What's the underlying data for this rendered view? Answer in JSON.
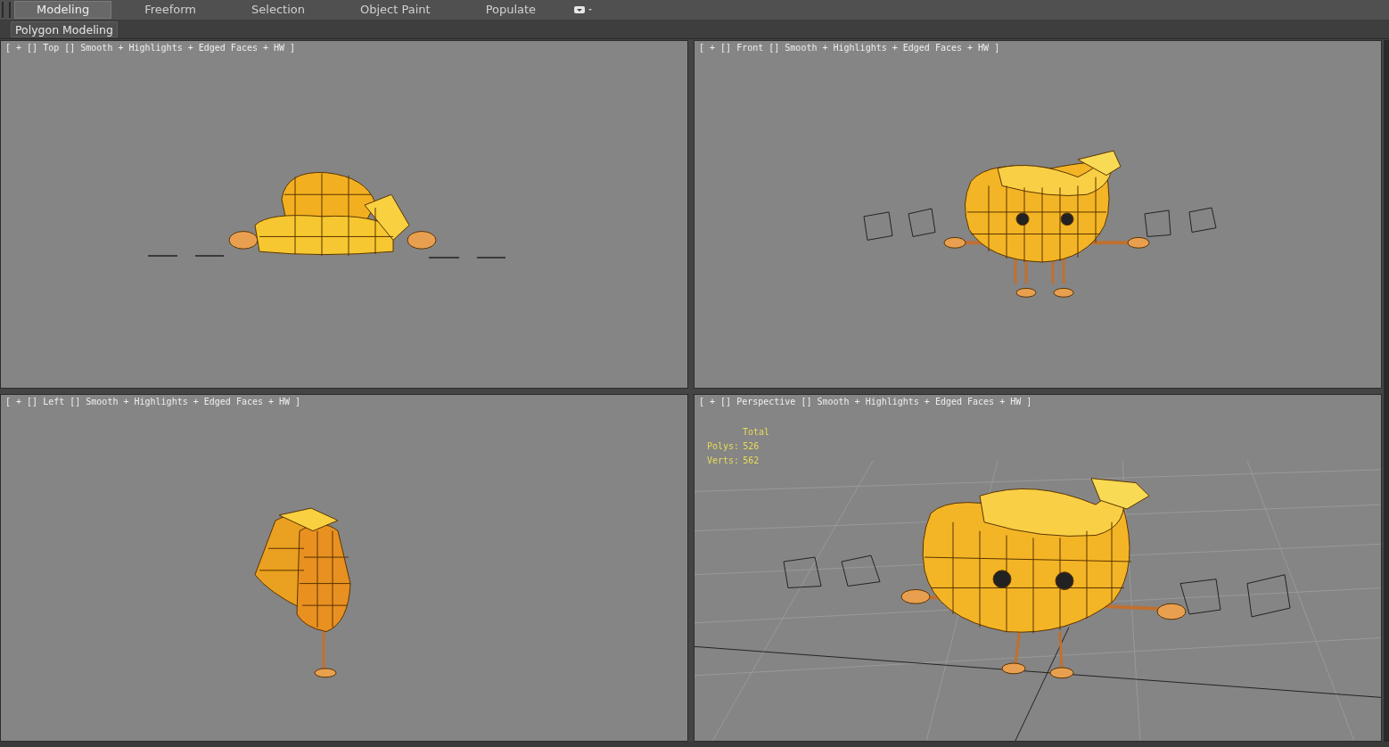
{
  "ribbon": {
    "tabs": [
      {
        "label": "Modeling",
        "selected": true
      },
      {
        "label": "Freeform",
        "selected": false
      },
      {
        "label": "Selection",
        "selected": false
      },
      {
        "label": "Object Paint",
        "selected": false
      },
      {
        "label": "Populate",
        "selected": false
      }
    ],
    "panel": "Polygon Modeling"
  },
  "viewports": [
    {
      "kind": "top",
      "label": "[ + [] Top [] Smooth + Highlights + Edged Faces + HW ]"
    },
    {
      "kind": "front",
      "label": "[ + [] Front [] Smooth + Highlights + Edged Faces + HW ]"
    },
    {
      "kind": "left",
      "label": "[ + [] Left [] Smooth + Highlights + Edged Faces + HW ]"
    },
    {
      "kind": "perspective",
      "label": "[ + [] Perspective [] Smooth + Highlights + Edged Faces + HW ]",
      "stats": {
        "title": "Total",
        "rows": [
          {
            "name": "Polys:",
            "value": "526"
          },
          {
            "name": "Verts:",
            "value": "562"
          }
        ]
      }
    }
  ]
}
